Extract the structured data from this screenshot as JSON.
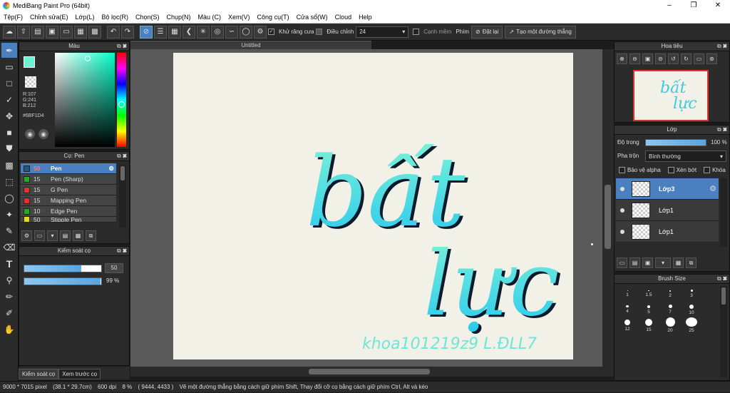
{
  "app": {
    "title": "MediBang Paint Pro (64bit)"
  },
  "menu": [
    "Tệp(F)",
    "Chỉnh sửa(E)",
    "Lớp(L)",
    "Bộ lọc(R)",
    "Chọn(S)",
    "Chụp(N)",
    "Màu (C)",
    "Xem(V)",
    "Công cụ(T)",
    "Cửa sổ(W)",
    "Cloud",
    "Help"
  ],
  "toolbar": {
    "anti_alias_label": "Khử răng cưa",
    "adjust_label": "Điều chỉnh",
    "adjust_value": "24",
    "edge_label": "Cạnh mềm",
    "key_label": "Phím",
    "reset_label": "Đặt lại",
    "line_label": "Tạo một đường thẳng"
  },
  "color_panel": {
    "title": "Màu",
    "r": "R:107",
    "g": "G:241",
    "b": "B:212",
    "hex": "#6BF1D4",
    "fg_color": "#6BF1D4",
    "bg_color": "#1DB5F0"
  },
  "brush_panel": {
    "title": "Cọ: Pen",
    "items": [
      {
        "size": "50",
        "name": "Pen",
        "color": "#1a5b8a"
      },
      {
        "size": "15",
        "name": "Pen (Sharp)",
        "color": "#22aa22"
      },
      {
        "size": "15",
        "name": "G Pen",
        "color": "#dd3333"
      },
      {
        "size": "15",
        "name": "Mapping Pen",
        "color": "#dd3333"
      },
      {
        "size": "10",
        "name": "Edge Pen",
        "color": "#22aa22"
      },
      {
        "size": "50",
        "name": "Stipple Pen",
        "color": "#dddd22"
      }
    ]
  },
  "brush_control": {
    "title": "Kiểm soát cọ",
    "size_value": "50",
    "size_level": 0.74,
    "opacity_value": "99 %",
    "opacity_level": 0.99
  },
  "bottom_tabs": [
    "Kiểm soát cọ",
    "Xem trước cọ"
  ],
  "canvas": {
    "tab_label": "Untitled",
    "art_main1": "bất",
    "art_main2": "lực",
    "art_sig": "khoa101219z9 L.ĐLL7"
  },
  "navigator": {
    "title": "Hoa tiêu",
    "thumb_text1": "bất",
    "thumb_text2": "lực"
  },
  "layers": {
    "title": "Lớp",
    "opacity_label": "Độ trong",
    "opacity_value": "100 %",
    "opacity_level": 1.0,
    "blend_label": "Pha trộn",
    "blend_value": "Bình thường",
    "protect_alpha": "Bảo vệ alpha",
    "clipping": "Xén bớt",
    "lock": "Khóa",
    "items": [
      {
        "name": "Lớp3",
        "selected": true
      },
      {
        "name": "Lớp1",
        "selected": false
      },
      {
        "name": "Lớp1",
        "selected": false
      }
    ]
  },
  "brush_size": {
    "title": "Brush Size",
    "sizes": [
      "1",
      "1.5",
      "2",
      "3",
      "4",
      "5",
      "7",
      "10",
      "12",
      "15",
      "20",
      "25"
    ]
  },
  "status": {
    "dimensions": "9000 * 7015 pixel",
    "physical": "(38.1 * 29.7cm)",
    "dpi": "600 dpi",
    "zoom": "8 %",
    "coords": "( 9444, 4433 )",
    "hint": "Vẽ một đường thẳng bằng cách giữ phím Shift, Thay đổi cỡ cọ bằng cách giữ phím Ctrl, Alt và kéo"
  }
}
